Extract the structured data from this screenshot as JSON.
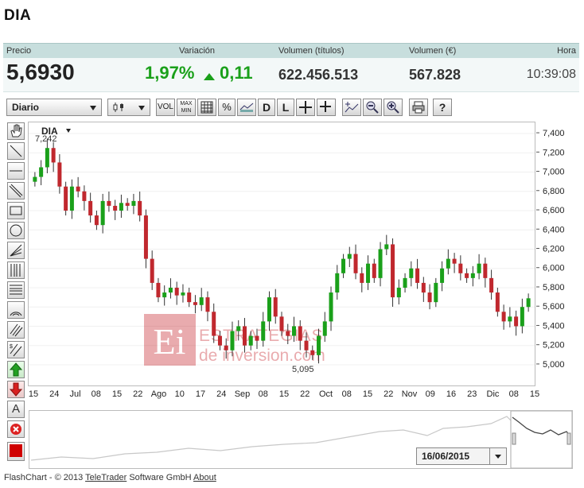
{
  "title": "DIA",
  "quote": {
    "headers": {
      "precio": "Precio",
      "variacion": "Variación",
      "vol_titulos": "Volumen (títulos)",
      "vol_eur": "Volumen (€)",
      "hora": "Hora"
    },
    "price": "5,6930",
    "change_pct": "1,97%",
    "change_abs": "0,11",
    "volume_shares": "622.456.513",
    "volume_eur": "567.828",
    "time": "10:39:08",
    "up_color": "#1aa01a"
  },
  "toolbar": {
    "period": "Diario",
    "vol": "VOL",
    "maxmin": "MAX MIN",
    "pct": "%",
    "d": "D",
    "l": "L"
  },
  "chart_data": {
    "type": "candlestick",
    "ticker_label": "DIA",
    "y_ticks": [
      "7,400",
      "7,200",
      "7,000",
      "6,800",
      "6,600",
      "6,400",
      "6,200",
      "6,000",
      "5,800",
      "5,600",
      "5,400",
      "5,200",
      "5,000"
    ],
    "ylim": [
      4.95,
      7.45
    ],
    "x_ticks": [
      "15",
      "24",
      "Jul",
      "08",
      "15",
      "22",
      "Ago",
      "10",
      "17",
      "24",
      "Sep",
      "08",
      "15",
      "22",
      "Oct",
      "08",
      "15",
      "22",
      "Nov",
      "09",
      "16",
      "23",
      "Dic",
      "08",
      "15"
    ],
    "high_annotation": "7,242",
    "low_annotation": "5,095",
    "closes": [
      6.95,
      7.05,
      7.25,
      7.1,
      6.85,
      6.6,
      6.85,
      6.8,
      6.7,
      6.55,
      6.45,
      6.7,
      6.65,
      6.6,
      6.68,
      6.65,
      6.7,
      6.55,
      6.1,
      5.85,
      5.7,
      5.75,
      5.8,
      5.72,
      5.75,
      5.65,
      5.62,
      5.7,
      5.55,
      5.3,
      5.2,
      5.15,
      5.35,
      5.4,
      5.2,
      5.3,
      5.25,
      5.45,
      5.7,
      5.5,
      5.35,
      5.3,
      5.4,
      5.25,
      5.15,
      5.1,
      5.3,
      5.45,
      5.75,
      5.95,
      6.1,
      6.15,
      5.95,
      5.85,
      6.05,
      5.9,
      6.2,
      6.25,
      5.7,
      5.8,
      5.9,
      6.0,
      5.85,
      5.75,
      5.65,
      5.85,
      6.0,
      6.1,
      6.05,
      5.95,
      5.9,
      5.95,
      6.05,
      5.9,
      5.75,
      5.55,
      5.45,
      5.5,
      5.4,
      5.6,
      5.69
    ],
    "up_color": "#1aa01a",
    "down_color": "#c0282e"
  },
  "navigator": {
    "date": "16/06/2015"
  },
  "watermark": {
    "logo": "Ei",
    "line1": "ESTRATEGIAS",
    "line2": "de inversion.com"
  },
  "footer": {
    "prefix": "FlashChart - © 2013",
    "link1": "TeleTrader",
    "middle": "Software GmbH",
    "link2": "About"
  }
}
